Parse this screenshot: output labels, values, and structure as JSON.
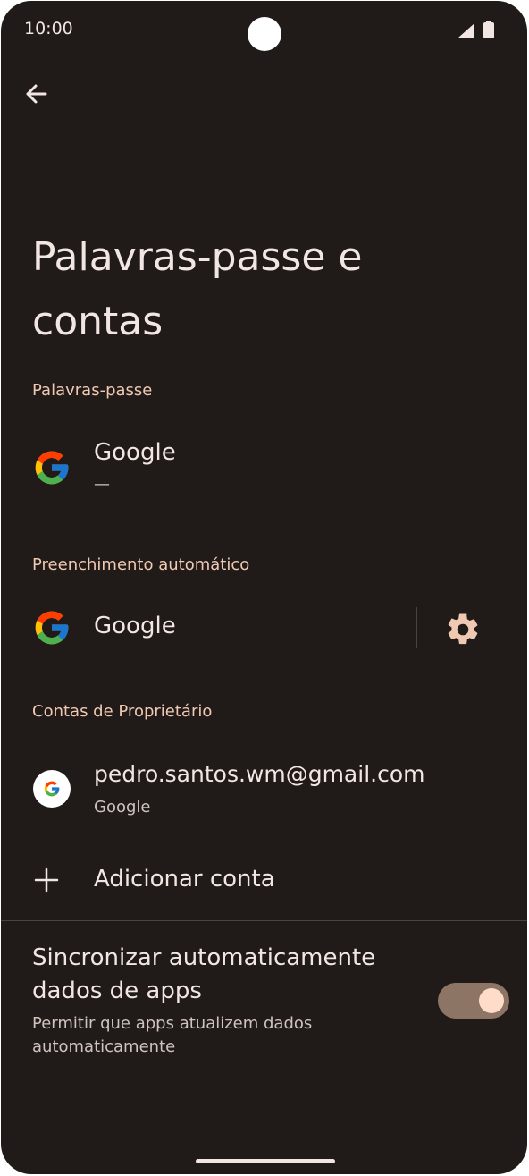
{
  "status_bar": {
    "time": "10:00"
  },
  "page": {
    "title": "Palavras-passe e contas"
  },
  "passwords": {
    "header": "Palavras-passe",
    "item": {
      "title": "Google",
      "subtitle": "—"
    }
  },
  "autofill": {
    "header": "Preenchimento automático",
    "item": {
      "title": "Google"
    }
  },
  "owner_accounts": {
    "header": "Contas de Proprietário",
    "account": {
      "email": "pedro.santos.wm@gmail.com",
      "provider": "Google"
    },
    "add_account_label": "Adicionar conta"
  },
  "sync": {
    "title": "Sincronizar automaticamente dados de apps",
    "subtitle": "Permitir que apps atualizem dados automaticamente",
    "enabled": true
  },
  "icons": {
    "back": "arrow-back-icon",
    "gear": "gear-icon",
    "add": "plus-icon",
    "google": "google-logo-icon"
  },
  "colors": {
    "background": "#201a18",
    "section_header": "#f0c9b3",
    "toggle_track": "#8c7565",
    "toggle_thumb": "#ffdbc9"
  }
}
